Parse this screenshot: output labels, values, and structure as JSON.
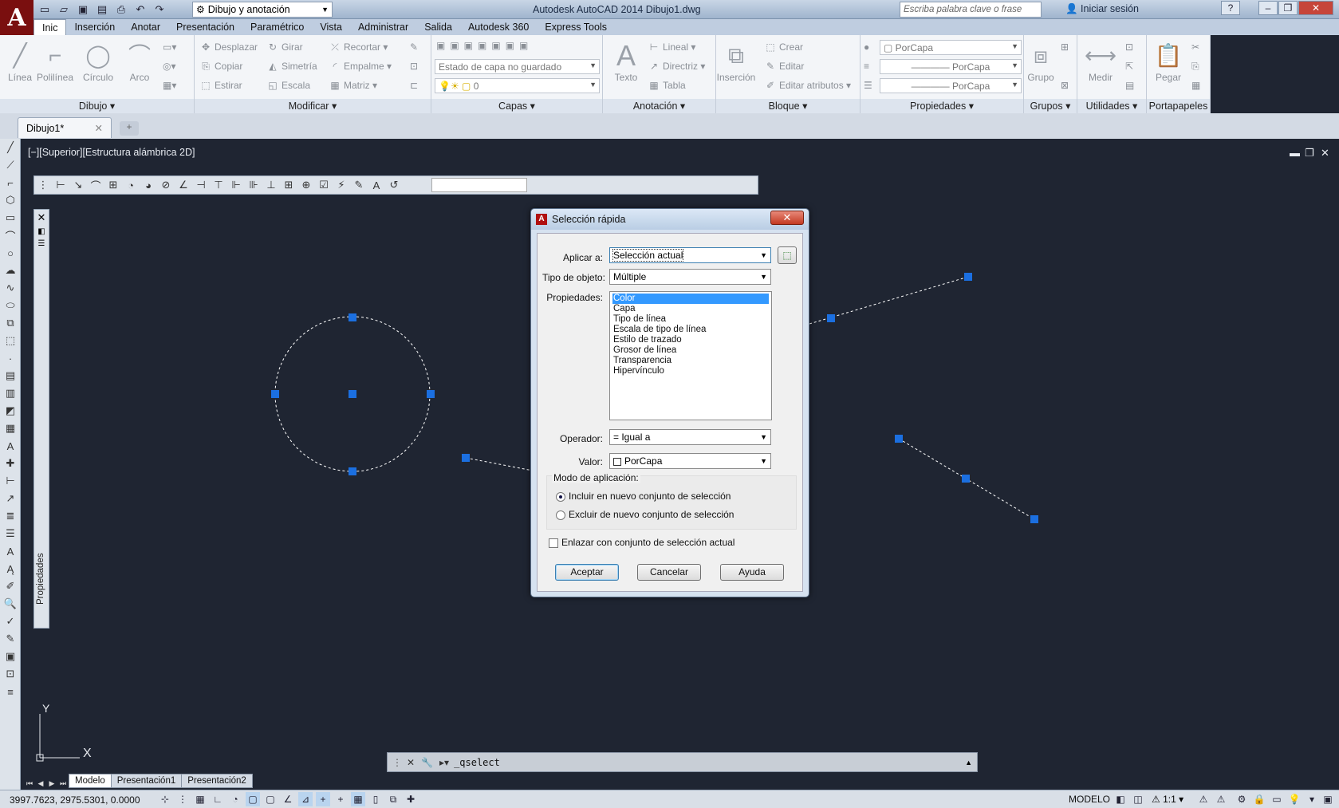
{
  "titlebar": {
    "workspace": "Dibujo y anotación",
    "title": "Autodesk AutoCAD 2014    Dibujo1.dwg",
    "search_placeholder": "Escriba palabra clave o frase",
    "signin": "Iniciar sesión"
  },
  "tabs": [
    "Inic",
    "Inserción",
    "Anotar",
    "Presentación",
    "Paramétrico",
    "Vista",
    "Administrar",
    "Salida",
    "Autodesk 360",
    "Express Tools"
  ],
  "ribbon": {
    "draw": {
      "label": "Dibujo",
      "linea": "Línea",
      "polilinea": "Polilínea",
      "circulo": "Círculo",
      "arco": "Arco"
    },
    "modify": {
      "label": "Modificar",
      "desplazar": "Desplazar",
      "girar": "Girar",
      "recortar": "Recortar",
      "copiar": "Copiar",
      "simetria": "Simetría",
      "empalme": "Empalme",
      "estirar": "Estirar",
      "escala": "Escala",
      "matriz": "Matriz"
    },
    "layers": {
      "label": "Capas",
      "state": "Estado de capa no guardado",
      "current": "0"
    },
    "annotation": {
      "label": "Anotación",
      "texto": "Texto",
      "lineal": "Lineal",
      "directriz": "Directriz",
      "tabla": "Tabla"
    },
    "block": {
      "label": "Bloque",
      "insercion": "Inserción",
      "crear": "Crear",
      "editar": "Editar",
      "editar_atributos": "Editar atributos"
    },
    "properties": {
      "label": "Propiedades",
      "color": "PorCapa",
      "linetype": "PorCapa",
      "lineweight": "PorCapa"
    },
    "groups": {
      "label": "Grupos",
      "grupo": "Grupo"
    },
    "utilities": {
      "label": "Utilidades",
      "medir": "Medir"
    },
    "clipboard": {
      "label": "Portapapeles",
      "pegar": "Pegar"
    }
  },
  "doc_tab": "Dibujo1*",
  "viewport_label": "[−][Superior][Estructura alámbrica 2D]",
  "properties_palette": "Propiedades",
  "dialog": {
    "title": "Selección rápida",
    "apply_to_label": "Aplicar a:",
    "apply_to_value": "Selección actual",
    "object_type_label": "Tipo de objeto:",
    "object_type_value": "Múltiple",
    "properties_label": "Propiedades:",
    "properties": [
      "Color",
      "Capa",
      "Tipo de línea",
      "Escala de tipo de línea",
      "Estilo de trazado",
      "Grosor de línea",
      "Transparencia",
      "Hipervínculo"
    ],
    "operator_label": "Operador:",
    "operator_value": "= Igual a",
    "value_label": "Valor:",
    "value_value": "PorCapa",
    "mode_label": "Modo de aplicación:",
    "include": "Incluir en nuevo conjunto de selección",
    "exclude": "Excluir de nuevo conjunto de selección",
    "append": "Enlazar con conjunto de selección actual",
    "ok": "Aceptar",
    "cancel": "Cancelar",
    "help": "Ayuda"
  },
  "command_line": "_qselect",
  "layout_tabs": [
    "Modelo",
    "Presentación1",
    "Presentación2"
  ],
  "status": {
    "coords": "3997.7623, 2975.5301, 0.0000",
    "model": "MODELO",
    "scale": "1:1"
  },
  "ucs": {
    "x": "X",
    "y": "Y"
  }
}
